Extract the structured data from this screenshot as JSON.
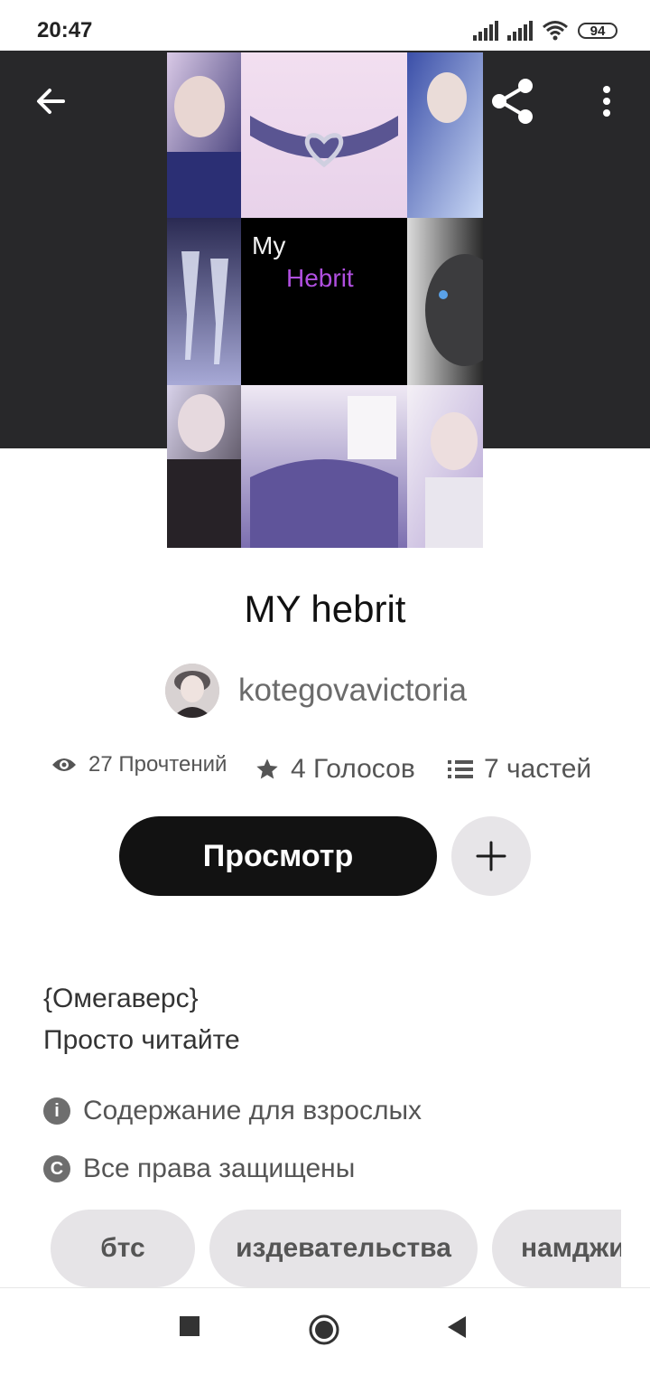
{
  "status_bar": {
    "time": "20:47",
    "battery": "94"
  },
  "header": {
    "back_icon": "arrow-left-icon",
    "share_icon": "share-icon",
    "more_icon": "more-vertical-icon"
  },
  "cover": {
    "title_line1": "My",
    "title_line2": "Hebrit"
  },
  "story": {
    "title": "MY hebrit",
    "author": "kotegovavictoria",
    "stats": {
      "reads": "27 Прочтений",
      "votes": "4 Голосов",
      "parts": "7 частей"
    },
    "read_button": "Просмотр",
    "add_icon": "plus-icon",
    "description_line1": "{Омегаверс}",
    "description_line2": "Просто читайте",
    "mature": "Содержание для взрослых",
    "copyright": "Все права защищены",
    "tags": [
      "бтс",
      "издевательства",
      "намджин"
    ]
  },
  "colors": {
    "header_bg": "#28282a",
    "primary_button": "#121212",
    "chip_bg": "#e6e4e7",
    "cover_accent": "#b04fe0"
  }
}
